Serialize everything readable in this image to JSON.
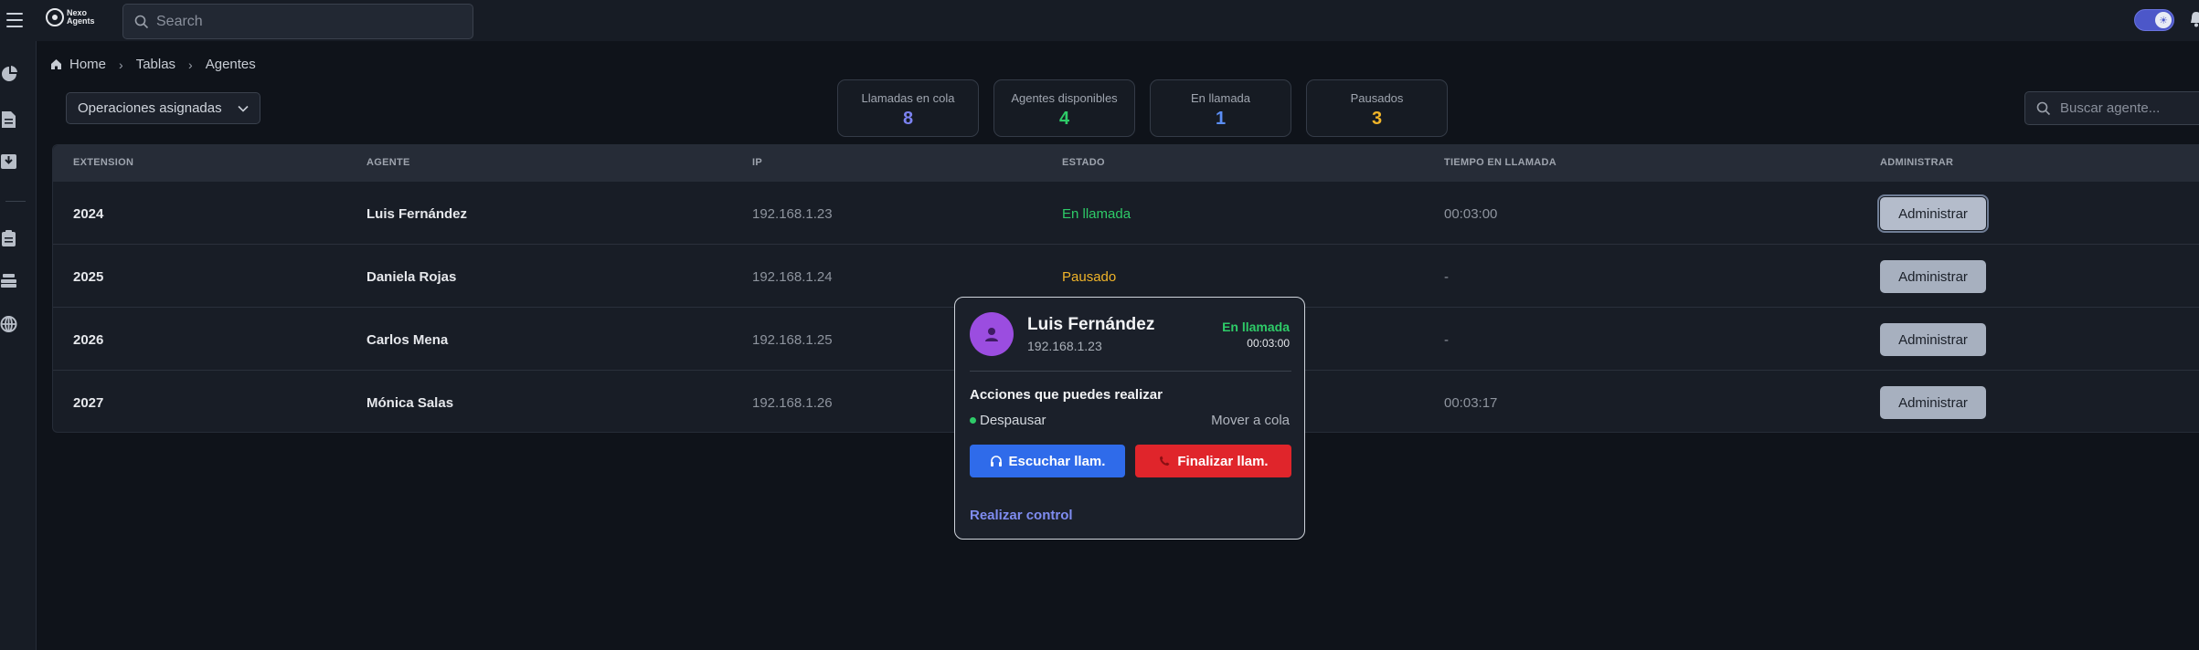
{
  "app": {
    "logo_text": "Nexo\nAgents",
    "search_placeholder": "Search"
  },
  "breadcrumb": [
    "Home",
    "Tablas",
    "Agentes"
  ],
  "filters": {
    "operations_label": "Operaciones asignadas",
    "agent_search_placeholder": "Buscar agente..."
  },
  "stats": [
    {
      "label": "Llamadas en cola",
      "value": "8",
      "color": "#7b82f0"
    },
    {
      "label": "Agentes disponibles",
      "value": "4",
      "color": "#2ecb68"
    },
    {
      "label": "En llamada",
      "value": "1",
      "color": "#5b8ef5"
    },
    {
      "label": "Pausados",
      "value": "3",
      "color": "#f0b429"
    }
  ],
  "table": {
    "headers": [
      "EXTENSION",
      "AGENTE",
      "IP",
      "ESTADO",
      "TIEMPO EN LLAMADA",
      "ADMINISTRAR"
    ],
    "rows": [
      {
        "ext": "2024",
        "agent": "Luis Fernández",
        "ip": "192.168.1.23",
        "status": "En llamada",
        "status_color": "#2ecb68",
        "time": "00:03:00",
        "action": "Administrar"
      },
      {
        "ext": "2025",
        "agent": "Daniela Rojas",
        "ip": "192.168.1.24",
        "status": "Pausado",
        "status_color": "#f0b429",
        "time": "-",
        "action": "Administrar"
      },
      {
        "ext": "2026",
        "agent": "Carlos Mena",
        "ip": "192.168.1.25",
        "status": "",
        "status_color": "#8e949e",
        "time": "-",
        "action": "Administrar"
      },
      {
        "ext": "2027",
        "agent": "Mónica Salas",
        "ip": "192.168.1.26",
        "status": "",
        "status_color": "#8e949e",
        "time": "00:03:17",
        "action": "Administrar"
      }
    ]
  },
  "popup": {
    "name": "Luis Fernández",
    "ip": "192.168.1.23",
    "status": "En llamada",
    "time": "00:03:00",
    "actions_title": "Acciones que puedes realizar",
    "unpause": "Despausar",
    "move_queue": "Mover a cola",
    "listen_button": "Escuchar llam.",
    "end_button": "Finalizar llam.",
    "control_link": "Realizar control"
  },
  "icons": {
    "menu": "hamburger-icon",
    "search": "search-icon",
    "theme_toggle": "sun-icon",
    "notifications": "bell-icon",
    "home": "home-icon",
    "chevron": "chevron-right-icon",
    "dropdown": "chevron-down-icon",
    "avatar": "user-icon",
    "headset": "headphones-icon",
    "hangup": "phone-off-icon"
  }
}
